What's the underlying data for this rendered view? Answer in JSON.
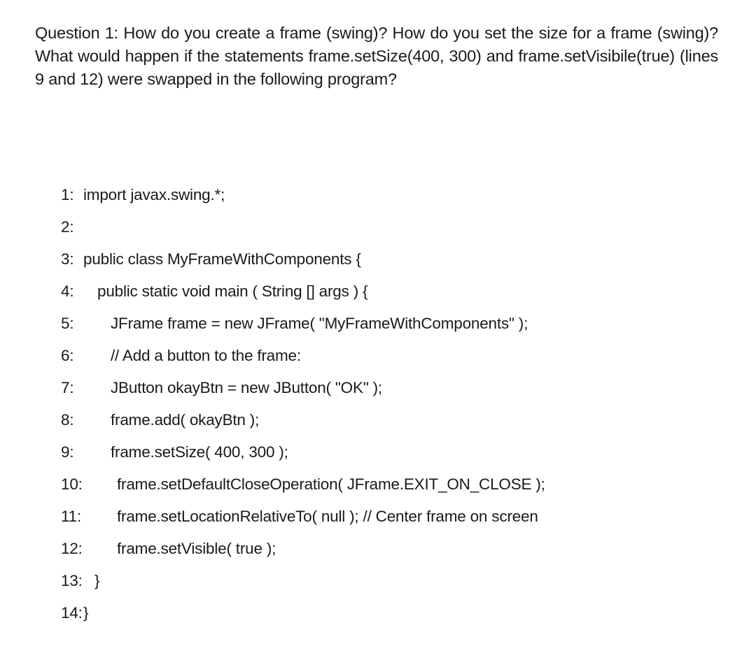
{
  "question": {
    "text": "Question 1: How do you create a frame (swing)? How do you set the size for a frame (swing)? What would happen if the statements frame.setSize(400, 300) and frame.setVisibile(true) (lines 9 and 12) were swapped in the following program?"
  },
  "code": {
    "lines": [
      {
        "num": "1:",
        "text": "import javax.swing.*;"
      },
      {
        "num": "2:",
        "text": ""
      },
      {
        "num": "3:",
        "text": "public class MyFrameWithComponents {"
      },
      {
        "num": "4:",
        "text": "public static void main ( String [] args ) {"
      },
      {
        "num": "5:",
        "text": "JFrame frame = new JFrame( \"MyFrameWithComponents\" );"
      },
      {
        "num": "6:",
        "text": "// Add a button to the frame:"
      },
      {
        "num": "7:",
        "text": "JButton okayBtn = new JButton( \"OK\" );"
      },
      {
        "num": "8:",
        "text": "frame.add( okayBtn );"
      },
      {
        "num": "9:",
        "text": "frame.setSize( 400, 300 );"
      },
      {
        "num": "10:",
        "text": "frame.setDefaultCloseOperation( JFrame.EXIT_ON_CLOSE );"
      },
      {
        "num": "11:",
        "text": "frame.setLocationRelativeTo( null ); // Center frame on screen"
      },
      {
        "num": "12:",
        "text": "frame.setVisible( true );"
      },
      {
        "num": "13:",
        "text": "}"
      },
      {
        "num": "14:",
        "text": "}"
      }
    ]
  }
}
